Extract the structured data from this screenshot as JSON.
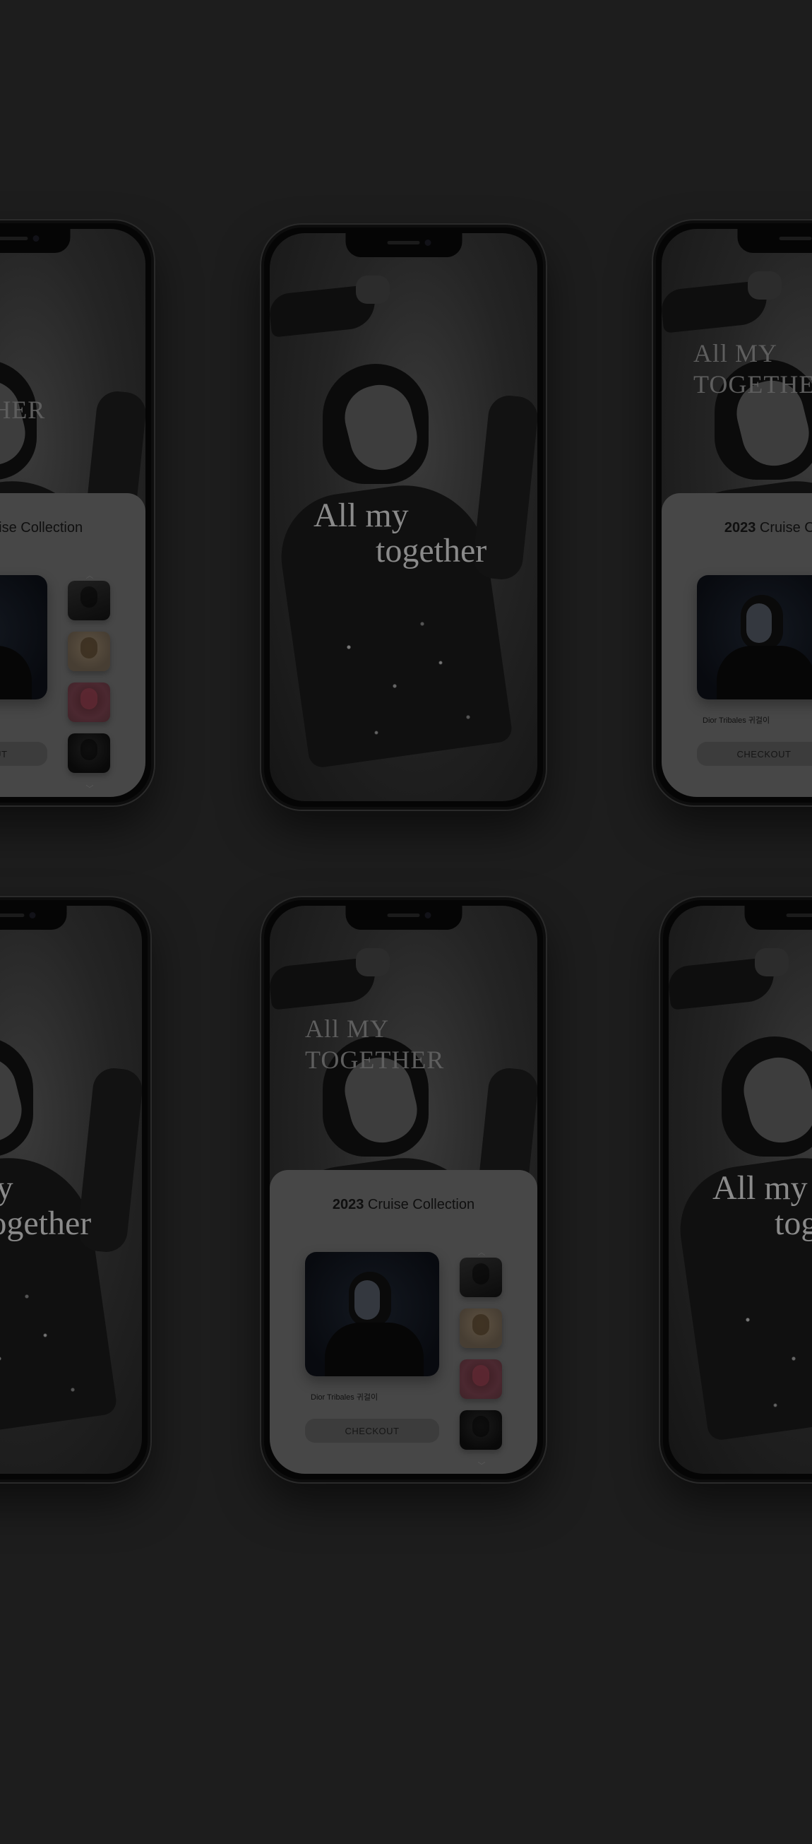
{
  "hero": {
    "script_line1": "All my",
    "script_line2": "together",
    "caps_line1": "All MY",
    "caps_line2": "TOGETHER"
  },
  "sheet": {
    "title_year": "2023",
    "title_rest": " Cruise Collection",
    "product_name": "Dior Tribales 귀걸이",
    "checkout_label": "CHECKOUT",
    "chevron_up": "︿",
    "chevron_down": "﹀"
  },
  "colors": {
    "background": "#1d1d1d",
    "sheet": "#474747"
  }
}
